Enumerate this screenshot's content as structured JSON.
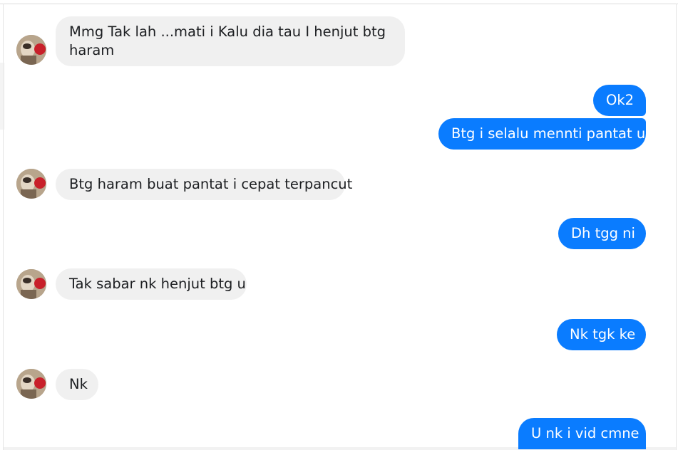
{
  "conversation": {
    "messages": [
      {
        "direction": "incoming",
        "text_line1": "Mmg Tak lah ...mati i Kalu dia tau I henjut btg",
        "text_line2": "haram"
      },
      {
        "direction": "outgoing",
        "text": "Ok2"
      },
      {
        "direction": "outgoing",
        "text": "Btg i selalu mennti pantat u"
      },
      {
        "direction": "incoming",
        "text": "Btg haram buat pantat i cepat terpancut"
      },
      {
        "direction": "outgoing",
        "text": "Dh tgg ni"
      },
      {
        "direction": "incoming",
        "text": "Tak sabar nk henjut btg u"
      },
      {
        "direction": "outgoing",
        "text": "Nk tgk ke"
      },
      {
        "direction": "incoming",
        "text": "Nk"
      },
      {
        "direction": "outgoing",
        "text": "U nk i vid cmne"
      }
    ],
    "contact_avatar_icon": "user-avatar-photo"
  },
  "colors": {
    "outgoing_bubble": "#0a7cff",
    "incoming_bubble": "#f0f0f0",
    "incoming_text": "#1c1e21",
    "outgoing_text": "#ffffff"
  }
}
